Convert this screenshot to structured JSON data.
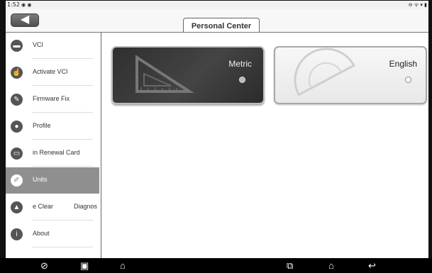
{
  "status_bar": {
    "time": "1:52",
    "left_icons": "◉ ◉",
    "right_icons": "⊖ ᯤ ▾ ▮"
  },
  "header": {
    "back_icon": "arrow-left-icon",
    "tab_title": "Personal Center"
  },
  "sidebar": {
    "items": [
      {
        "label": "VCI",
        "icon": "vci-icon"
      },
      {
        "label": "Activate VCI",
        "icon": "hand-icon"
      },
      {
        "label": "Firmware Fix",
        "icon": "wrench-icon"
      },
      {
        "label": "Profile",
        "icon": "person-icon"
      },
      {
        "label": "in Renewal Card",
        "icon": "card-icon"
      },
      {
        "label": "Units",
        "icon": "ruler-icon",
        "active": true
      },
      {
        "label": "e Clear",
        "label2": "Diagnos",
        "icon": "bell-icon"
      },
      {
        "label": "About",
        "icon": "info-icon"
      }
    ]
  },
  "units": {
    "metric_label": "Metric",
    "english_label": "English",
    "selected": "Metric"
  },
  "nav_bar": {
    "icons": [
      "browser-icon",
      "gallery-icon",
      "car-icon",
      "recent-apps-icon",
      "home-icon",
      "back-icon"
    ]
  }
}
